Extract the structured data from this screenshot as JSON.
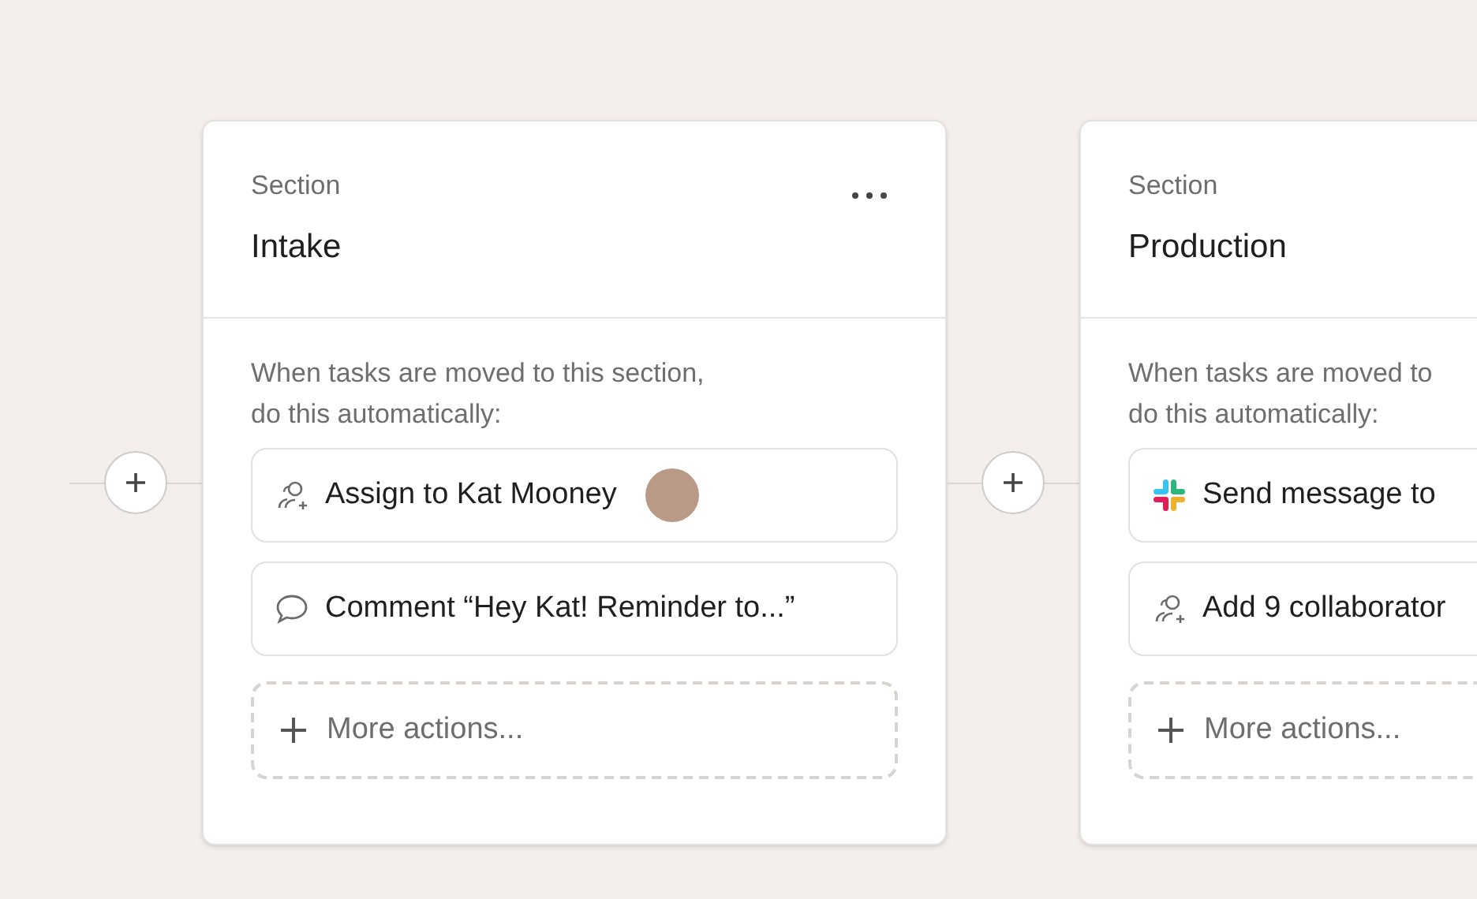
{
  "sections": [
    {
      "label": "Section",
      "title": "Intake",
      "menu": true,
      "description": "When tasks are moved to this section,\ndo this automatically:",
      "actions": [
        {
          "kind": "assign",
          "text": "Assign to Kat Mooney"
        },
        {
          "kind": "comment",
          "text": "Comment “Hey Kat! Reminder to...”"
        }
      ],
      "more": "More actions..."
    },
    {
      "label": "Section",
      "title": "Production",
      "menu": false,
      "description": "When tasks are moved to\ndo this automatically:",
      "actions": [
        {
          "kind": "slack",
          "text": "Send message to"
        },
        {
          "kind": "collaborators",
          "text": "Add 9 collaborator"
        }
      ],
      "more": "More actions..."
    }
  ]
}
